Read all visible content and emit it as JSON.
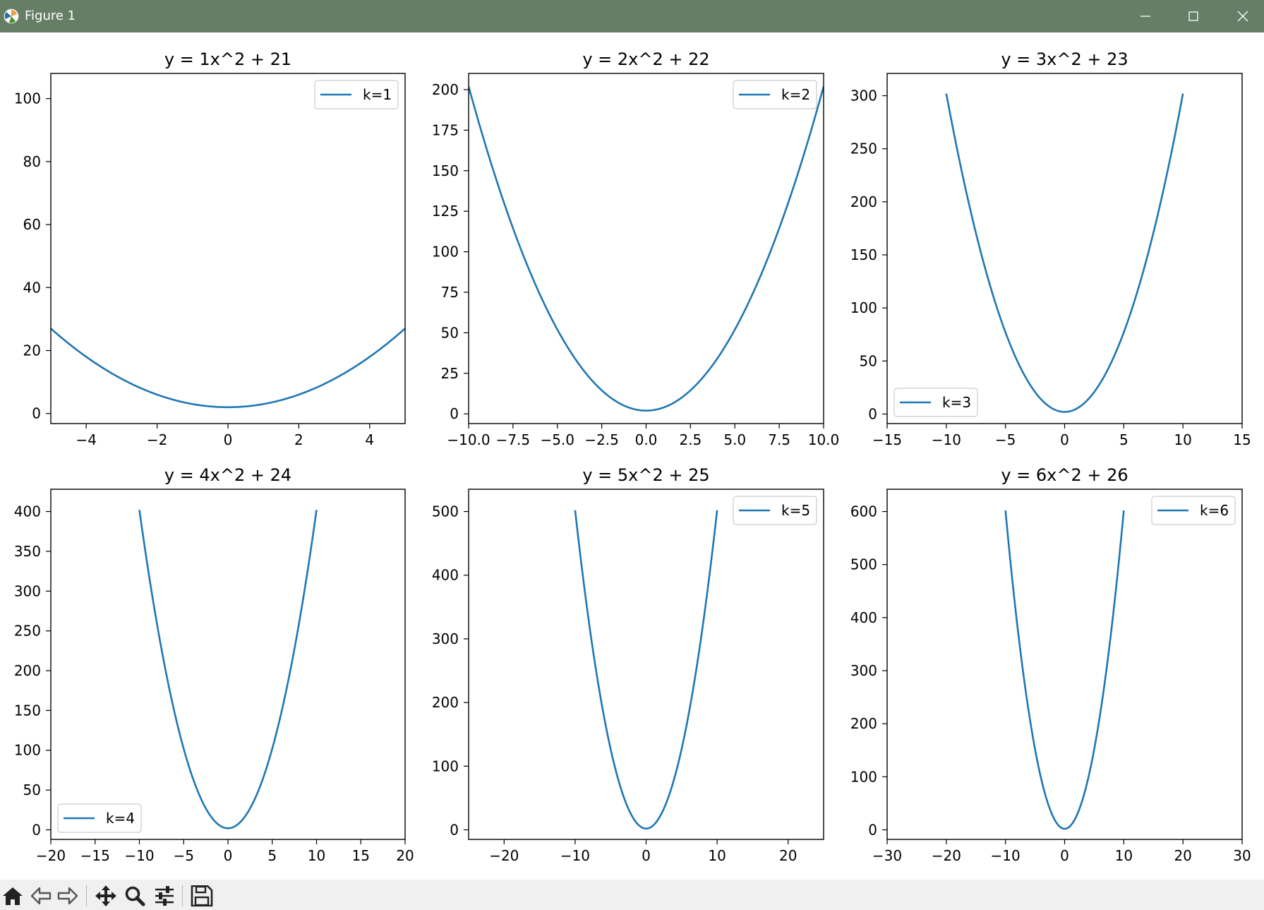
{
  "window": {
    "title": "Figure 1",
    "minimize_icon": "minimize-icon",
    "maximize_icon": "maximize-icon",
    "close_icon": "close-icon"
  },
  "toolbar": {
    "buttons": [
      {
        "name": "home-icon"
      },
      {
        "name": "back-arrow-icon"
      },
      {
        "name": "forward-arrow-icon"
      },
      {
        "name": "pan-move-icon"
      },
      {
        "name": "zoom-magnifier-icon"
      },
      {
        "name": "configure-subplots-icon"
      },
      {
        "name": "save-floppy-icon"
      }
    ]
  },
  "colors": {
    "line": "#1f77b4",
    "titlebar": "#657e65",
    "toolbar": "#f0f0f0"
  },
  "chart_data": [
    {
      "type": "line",
      "title": "y = 1x^2 + 21",
      "legend": "k=1",
      "legend_loc": "upper right",
      "k": 1,
      "x_range": [
        -5,
        5
      ],
      "xlim": [
        -5,
        5
      ],
      "ylim": [
        -3.2,
        108
      ],
      "xticks": [
        -4,
        -2,
        0,
        2,
        4
      ],
      "xtick_labels": [
        "−4",
        "−2",
        "0",
        "2",
        "4"
      ],
      "yticks": [
        0,
        20,
        40,
        60,
        80,
        100
      ],
      "ytick_labels": [
        "0",
        "20",
        "40",
        "60",
        "80",
        "100"
      ]
    },
    {
      "type": "line",
      "title": "y = 2x^2 + 22",
      "legend": "k=2",
      "legend_loc": "upper right",
      "k": 2,
      "x_range": [
        -10,
        10
      ],
      "xlim": [
        -10,
        10
      ],
      "ylim": [
        -6,
        210
      ],
      "xticks": [
        -10,
        -7.5,
        -5,
        -2.5,
        0,
        2.5,
        5,
        7.5,
        10
      ],
      "xtick_labels": [
        "−10.0",
        "−7.5",
        "−5.0",
        "−2.5",
        "0.0",
        "2.5",
        "5.0",
        "7.5",
        "10.0"
      ],
      "yticks": [
        0,
        25,
        50,
        75,
        100,
        125,
        150,
        175,
        200
      ],
      "ytick_labels": [
        "0",
        "25",
        "50",
        "75",
        "100",
        "125",
        "150",
        "175",
        "200"
      ]
    },
    {
      "type": "line",
      "title": "y = 3x^2 + 23",
      "legend": "k=3",
      "legend_loc": "lower left",
      "k": 3,
      "x_range": [
        -10,
        10
      ],
      "xlim": [
        -15,
        15
      ],
      "ylim": [
        -9,
        321
      ],
      "xticks": [
        -15,
        -10,
        -5,
        0,
        5,
        10,
        15
      ],
      "xtick_labels": [
        "−15",
        "−10",
        "−5",
        "0",
        "5",
        "10",
        "15"
      ],
      "yticks": [
        0,
        50,
        100,
        150,
        200,
        250,
        300
      ],
      "ytick_labels": [
        "0",
        "50",
        "100",
        "150",
        "200",
        "250",
        "300"
      ]
    },
    {
      "type": "line",
      "title": "y = 4x^2 + 24",
      "legend": "k=4",
      "legend_loc": "lower left",
      "k": 4,
      "x_range": [
        -10,
        10
      ],
      "xlim": [
        -20,
        20
      ],
      "ylim": [
        -12,
        428
      ],
      "xticks": [
        -20,
        -15,
        -10,
        -5,
        0,
        5,
        10,
        15,
        20
      ],
      "xtick_labels": [
        "−20",
        "−15",
        "−10",
        "−5",
        "0",
        "5",
        "10",
        "15",
        "20"
      ],
      "yticks": [
        0,
        50,
        100,
        150,
        200,
        250,
        300,
        350,
        400
      ],
      "ytick_labels": [
        "0",
        "50",
        "100",
        "150",
        "200",
        "250",
        "300",
        "350",
        "400"
      ]
    },
    {
      "type": "line",
      "title": "y = 5x^2 + 25",
      "legend": "k=5",
      "legend_loc": "upper right",
      "k": 5,
      "x_range": [
        -10,
        10
      ],
      "xlim": [
        -25,
        25
      ],
      "ylim": [
        -15,
        535
      ],
      "xticks": [
        -20,
        -10,
        0,
        10,
        20
      ],
      "xtick_labels": [
        "−20",
        "−10",
        "0",
        "10",
        "20"
      ],
      "yticks": [
        0,
        100,
        200,
        300,
        400,
        500
      ],
      "ytick_labels": [
        "0",
        "100",
        "200",
        "300",
        "400",
        "500"
      ]
    },
    {
      "type": "line",
      "title": "y = 6x^2 + 26",
      "legend": "k=6",
      "legend_loc": "upper right",
      "k": 6,
      "x_range": [
        -10,
        10
      ],
      "xlim": [
        -30,
        30
      ],
      "ylim": [
        -18,
        642
      ],
      "xticks": [
        -30,
        -20,
        -10,
        0,
        10,
        20,
        30
      ],
      "xtick_labels": [
        "−30",
        "−20",
        "−10",
        "0",
        "10",
        "20",
        "30"
      ],
      "yticks": [
        0,
        100,
        200,
        300,
        400,
        500,
        600
      ],
      "ytick_labels": [
        "0",
        "100",
        "200",
        "300",
        "400",
        "500",
        "600"
      ]
    }
  ]
}
